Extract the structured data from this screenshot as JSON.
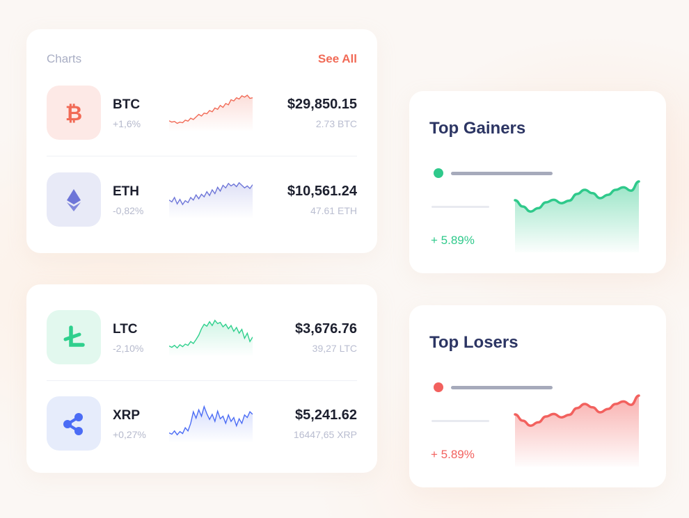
{
  "charts_card": {
    "title": "Charts",
    "see_all": "See All"
  },
  "coins": [
    {
      "symbol": "BTC",
      "change": "+1,6%",
      "price": "$29,850.15",
      "amount": "2.73 BTC",
      "icon": "bitcoin-icon",
      "color": "#f16a56",
      "icon_bg": "#fde9e6",
      "sparkline": [
        0.18,
        0.14,
        0.16,
        0.1,
        0.14,
        0.12,
        0.2,
        0.17,
        0.26,
        0.22,
        0.3,
        0.38,
        0.33,
        0.42,
        0.4,
        0.5,
        0.46,
        0.58,
        0.54,
        0.66,
        0.6,
        0.72,
        0.68,
        0.84,
        0.8,
        0.9,
        0.86,
        0.96,
        0.92,
        0.98,
        0.88,
        0.9
      ]
    },
    {
      "symbol": "ETH",
      "change": "-0,82%",
      "price": "$10,561.24",
      "amount": "47.61 ETH",
      "icon": "ethereum-icon",
      "color": "#6d75d8",
      "icon_bg": "#e8eaf7",
      "sparkline": [
        0.42,
        0.36,
        0.5,
        0.3,
        0.44,
        0.28,
        0.4,
        0.34,
        0.5,
        0.42,
        0.58,
        0.46,
        0.6,
        0.52,
        0.68,
        0.56,
        0.74,
        0.62,
        0.82,
        0.7,
        0.88,
        0.8,
        0.94,
        0.86,
        0.92,
        0.84,
        0.96,
        0.88,
        0.8,
        0.86,
        0.78,
        0.9
      ]
    },
    {
      "symbol": "LTC",
      "change": "-2,10%",
      "price": "$3,676.76",
      "amount": "39,27 LTC",
      "icon": "litecoin-icon",
      "color": "#2fd08d",
      "icon_bg": "#e2f8ee",
      "sparkline": [
        0.16,
        0.12,
        0.18,
        0.1,
        0.2,
        0.14,
        0.22,
        0.18,
        0.3,
        0.24,
        0.36,
        0.5,
        0.7,
        0.84,
        0.78,
        0.92,
        0.8,
        0.96,
        0.86,
        0.9,
        0.76,
        0.84,
        0.7,
        0.8,
        0.62,
        0.74,
        0.56,
        0.68,
        0.4,
        0.56,
        0.3,
        0.44
      ]
    },
    {
      "symbol": "XRP",
      "change": "+0,27%",
      "price": "$5,241.62",
      "amount": "16447,65 XRP",
      "icon": "ripple-icon",
      "color": "#4b6cf5",
      "icon_bg": "#e6ecfb",
      "sparkline": [
        0.14,
        0.1,
        0.2,
        0.08,
        0.18,
        0.12,
        0.3,
        0.2,
        0.44,
        0.8,
        0.6,
        0.86,
        0.66,
        0.96,
        0.74,
        0.56,
        0.72,
        0.5,
        0.82,
        0.58,
        0.66,
        0.44,
        0.7,
        0.5,
        0.62,
        0.36,
        0.58,
        0.44,
        0.7,
        0.62,
        0.8,
        0.72
      ]
    }
  ],
  "top_gainers": {
    "title": "Top Gainers",
    "percent": "+ 5.89%",
    "color": "#2fc98b",
    "series": [
      0.55,
      0.4,
      0.28,
      0.36,
      0.5,
      0.56,
      0.48,
      0.54,
      0.7,
      0.8,
      0.72,
      0.6,
      0.68,
      0.8,
      0.86,
      0.78,
      1.0
    ]
  },
  "top_losers": {
    "title": "Top Losers",
    "percent": "+ 5.89%",
    "color": "#f2615e",
    "series": [
      0.55,
      0.4,
      0.28,
      0.36,
      0.5,
      0.56,
      0.48,
      0.54,
      0.7,
      0.8,
      0.72,
      0.6,
      0.68,
      0.8,
      0.86,
      0.78,
      1.0
    ]
  }
}
